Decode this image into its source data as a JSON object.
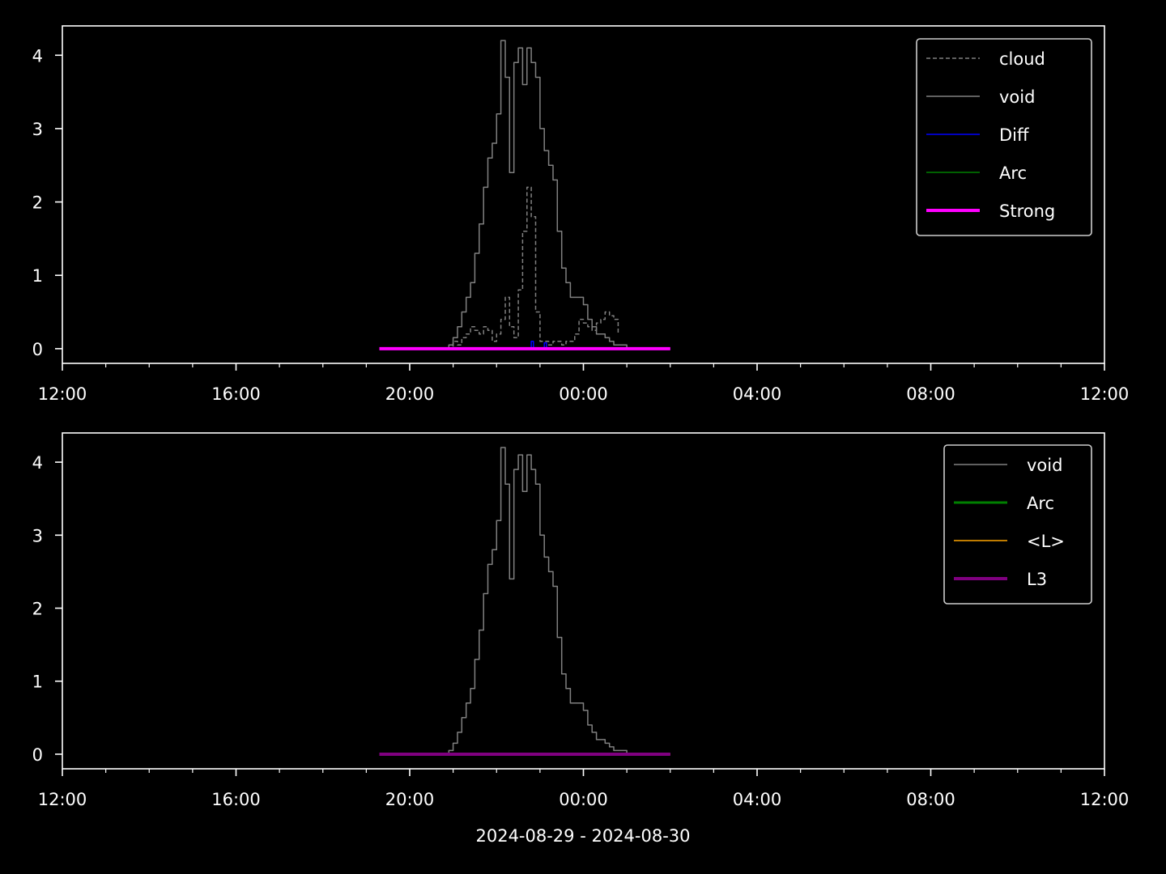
{
  "figure": {
    "background": "#000000",
    "foreground": "#ffffff",
    "xlabel": "2024-08-29 - 2024-08-30"
  },
  "chart_data": [
    {
      "type": "line",
      "x_unit": "hours since 2024-08-29 12:00",
      "xlim": [
        0,
        24
      ],
      "ylim": [
        -0.2,
        4.4
      ],
      "xticks": [
        {
          "v": 0,
          "label": "12:00"
        },
        {
          "v": 4,
          "label": "16:00"
        },
        {
          "v": 8,
          "label": "20:00"
        },
        {
          "v": 12,
          "label": "00:00"
        },
        {
          "v": 16,
          "label": "04:00"
        },
        {
          "v": 20,
          "label": "08:00"
        },
        {
          "v": 24,
          "label": "12:00"
        }
      ],
      "yticks": [
        {
          "v": 0,
          "label": "0"
        },
        {
          "v": 1,
          "label": "1"
        },
        {
          "v": 2,
          "label": "2"
        },
        {
          "v": 3,
          "label": "3"
        },
        {
          "v": 4,
          "label": "4"
        }
      ],
      "legend_position": "top-right",
      "series": [
        {
          "name": "cloud",
          "color": "#808080",
          "style": "dashed",
          "width": 1.5,
          "step": true,
          "x": [
            8.9,
            9.0,
            9.1,
            9.2,
            9.3,
            9.4,
            9.5,
            9.6,
            9.7,
            9.8,
            9.9,
            10.0,
            10.1,
            10.2,
            10.3,
            10.4,
            10.5,
            10.6,
            10.7,
            10.8,
            10.9,
            11.0,
            11.1,
            11.2,
            11.3,
            11.4,
            11.5,
            11.6,
            11.7,
            11.8,
            11.9,
            12.0,
            12.1,
            12.2,
            12.3,
            12.4,
            12.5,
            12.6,
            12.7,
            12.8
          ],
          "y": [
            0.0,
            0.1,
            0.05,
            0.15,
            0.2,
            0.3,
            0.25,
            0.2,
            0.3,
            0.25,
            0.1,
            0.2,
            0.4,
            0.7,
            0.3,
            0.15,
            0.8,
            1.6,
            2.2,
            1.8,
            0.5,
            0.1,
            0.1,
            0.05,
            0.1,
            0.1,
            0.05,
            0.1,
            0.1,
            0.2,
            0.4,
            0.35,
            0.3,
            0.25,
            0.35,
            0.4,
            0.5,
            0.45,
            0.4,
            0.2
          ]
        },
        {
          "name": "void",
          "color": "#808080",
          "style": "solid",
          "width": 1.5,
          "step": true,
          "x": [
            8.8,
            8.9,
            9.0,
            9.1,
            9.2,
            9.3,
            9.4,
            9.5,
            9.6,
            9.7,
            9.8,
            9.9,
            10.0,
            10.1,
            10.2,
            10.3,
            10.4,
            10.5,
            10.6,
            10.7,
            10.8,
            10.9,
            11.0,
            11.1,
            11.2,
            11.3,
            11.4,
            11.5,
            11.6,
            11.7,
            11.8,
            11.9,
            12.0,
            12.1,
            12.2,
            12.3,
            12.4,
            12.5,
            12.6,
            12.7,
            12.8,
            12.9,
            13.0,
            13.1,
            13.2
          ],
          "y": [
            0.0,
            0.05,
            0.15,
            0.3,
            0.5,
            0.7,
            0.9,
            1.3,
            1.7,
            2.2,
            2.6,
            2.8,
            3.2,
            4.2,
            3.7,
            2.4,
            3.9,
            4.1,
            3.6,
            4.1,
            3.9,
            3.7,
            3.0,
            2.7,
            2.5,
            2.3,
            1.6,
            1.1,
            0.9,
            0.7,
            0.7,
            0.7,
            0.6,
            0.4,
            0.3,
            0.2,
            0.2,
            0.15,
            0.1,
            0.05,
            0.05,
            0.05,
            0.0,
            0.0,
            0.0
          ]
        },
        {
          "name": "Diff",
          "color": "#0000ff",
          "style": "solid",
          "width": 1.5,
          "step": false,
          "x": [
            7.3,
            10.8,
            10.8,
            10.85,
            10.85,
            11.1,
            11.1,
            11.15,
            11.15,
            14.0
          ],
          "y": [
            0,
            0,
            0.1,
            0.1,
            0,
            0,
            0.08,
            0.08,
            0,
            0
          ]
        },
        {
          "name": "Arc",
          "color": "#008000",
          "style": "solid",
          "width": 1.5,
          "step": false,
          "x": [
            7.3,
            14.0
          ],
          "y": [
            0,
            0
          ]
        },
        {
          "name": "Strong",
          "color": "#ff00ff",
          "style": "solid",
          "width": 4,
          "step": false,
          "x": [
            7.3,
            14.0
          ],
          "y": [
            0,
            0
          ]
        }
      ]
    },
    {
      "type": "line",
      "x_unit": "hours since 2024-08-29 12:00",
      "xlim": [
        0,
        24
      ],
      "ylim": [
        -0.2,
        4.4
      ],
      "xticks": [
        {
          "v": 0,
          "label": "12:00"
        },
        {
          "v": 4,
          "label": "16:00"
        },
        {
          "v": 8,
          "label": "20:00"
        },
        {
          "v": 12,
          "label": "00:00"
        },
        {
          "v": 16,
          "label": "04:00"
        },
        {
          "v": 20,
          "label": "08:00"
        },
        {
          "v": 24,
          "label": "12:00"
        }
      ],
      "yticks": [
        {
          "v": 0,
          "label": "0"
        },
        {
          "v": 1,
          "label": "1"
        },
        {
          "v": 2,
          "label": "2"
        },
        {
          "v": 3,
          "label": "3"
        },
        {
          "v": 4,
          "label": "4"
        }
      ],
      "legend_position": "top-right",
      "series": [
        {
          "name": "void",
          "color": "#808080",
          "style": "solid",
          "width": 1.5,
          "step": true,
          "x": [
            8.8,
            8.9,
            9.0,
            9.1,
            9.2,
            9.3,
            9.4,
            9.5,
            9.6,
            9.7,
            9.8,
            9.9,
            10.0,
            10.1,
            10.2,
            10.3,
            10.4,
            10.5,
            10.6,
            10.7,
            10.8,
            10.9,
            11.0,
            11.1,
            11.2,
            11.3,
            11.4,
            11.5,
            11.6,
            11.7,
            11.8,
            11.9,
            12.0,
            12.1,
            12.2,
            12.3,
            12.4,
            12.5,
            12.6,
            12.7,
            12.8,
            12.9,
            13.0,
            13.1,
            13.2
          ],
          "y": [
            0.0,
            0.05,
            0.15,
            0.3,
            0.5,
            0.7,
            0.9,
            1.3,
            1.7,
            2.2,
            2.6,
            2.8,
            3.2,
            4.2,
            3.7,
            2.4,
            3.9,
            4.1,
            3.6,
            4.1,
            3.9,
            3.7,
            3.0,
            2.7,
            2.5,
            2.3,
            1.6,
            1.1,
            0.9,
            0.7,
            0.7,
            0.7,
            0.6,
            0.4,
            0.3,
            0.2,
            0.2,
            0.15,
            0.1,
            0.05,
            0.05,
            0.05,
            0.0,
            0.0,
            0.0
          ]
        },
        {
          "name": "Arc",
          "color": "#008000",
          "style": "solid",
          "width": 3,
          "step": false,
          "x": [
            7.3,
            14.0
          ],
          "y": [
            0,
            0
          ]
        },
        {
          "name": "<L>",
          "color": "#ffa500",
          "style": "solid",
          "width": 1.5,
          "step": false,
          "x": [
            7.3,
            14.0
          ],
          "y": [
            0,
            0
          ]
        },
        {
          "name": "L3",
          "color": "#800080",
          "style": "solid",
          "width": 4,
          "step": false,
          "x": [
            7.3,
            14.0
          ],
          "y": [
            0,
            0
          ]
        }
      ]
    }
  ]
}
